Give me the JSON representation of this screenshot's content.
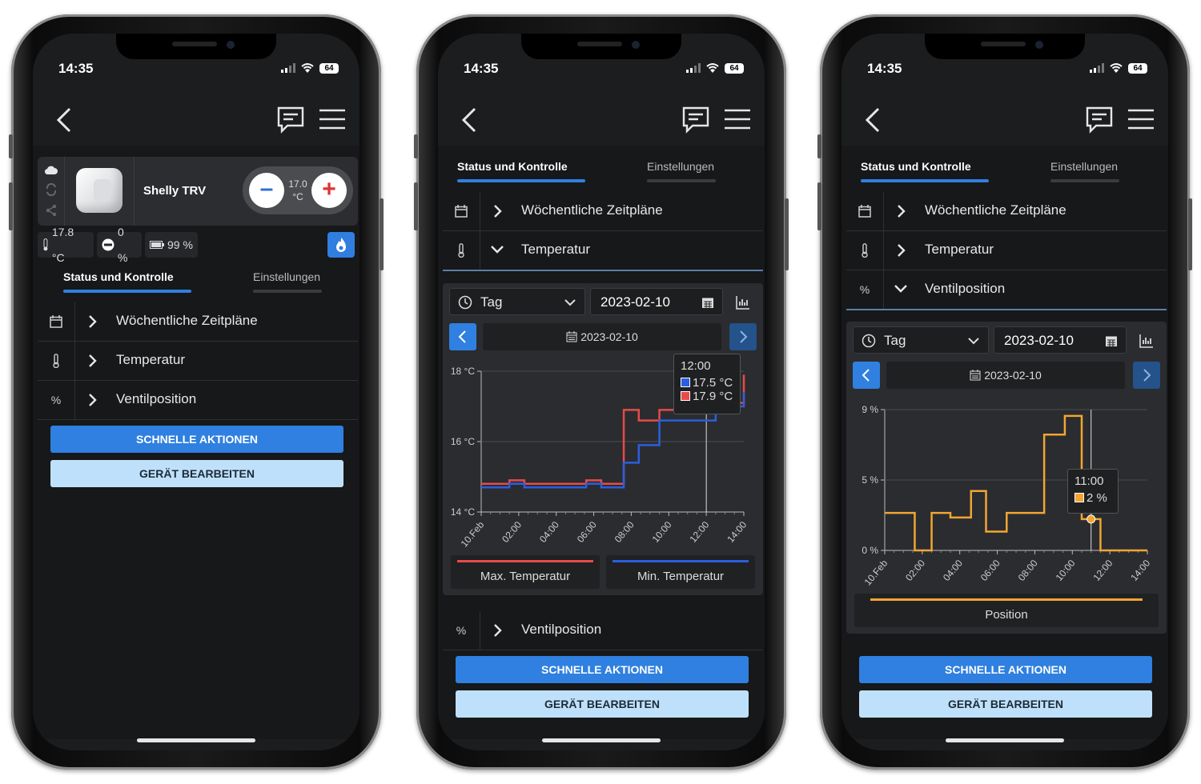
{
  "status": {
    "time": "14:35",
    "battery": "64"
  },
  "device": {
    "name": "Shelly TRV",
    "setpoint_value": "17.0",
    "setpoint_unit": "°C",
    "minus_label": "–",
    "plus_label": "+",
    "temperature": "17.8 °C",
    "valve": "0 %",
    "battery": "99 %"
  },
  "tabs": {
    "status": "Status und Kontrolle",
    "settings": "Einstellungen"
  },
  "sections": {
    "schedule": "Wöchentliche Zeitpläne",
    "temperature": "Temperatur",
    "valve": "Ventilposition"
  },
  "icons": {
    "schedule": "calendar-icon",
    "temperature": "thermometer-icon",
    "valve": "percent-icon"
  },
  "percent_symbol": "%",
  "buttons": {
    "quick_actions": "SCHNELLE AKTIONEN",
    "edit_device": "GERÄT BEARBEITEN"
  },
  "chart_controls": {
    "period": "Tag",
    "date": "2023-02-10",
    "nav_date": "2023-02-10"
  },
  "colors": {
    "accent": "#2f80e0",
    "max_temp": "#e84a4a",
    "min_temp": "#2b5fe0",
    "position": "#f2a533"
  },
  "chart_data": [
    {
      "type": "line",
      "x_ticks": [
        "10.Feb",
        "02:00",
        "04:00",
        "06:00",
        "08:00",
        "10:00",
        "12:00",
        "14:00"
      ],
      "y_ticks": [
        "18 °C",
        "16 °C",
        "14 °C"
      ],
      "ylim": [
        14,
        18
      ],
      "xlim": [
        0,
        14
      ],
      "series": [
        {
          "name": "Max. Temperatur",
          "color": "#e84a4a",
          "points": [
            [
              0,
              14.8
            ],
            [
              1.5,
              14.9
            ],
            [
              2.3,
              14.8
            ],
            [
              5.6,
              14.9
            ],
            [
              6.4,
              14.8
            ],
            [
              7.6,
              16.9
            ],
            [
              8.4,
              16.6
            ],
            [
              9.5,
              16.9
            ],
            [
              12.5,
              17.1
            ],
            [
              14,
              17.9
            ]
          ]
        },
        {
          "name": "Min. Temperatur",
          "color": "#2b5fe0",
          "points": [
            [
              0,
              14.7
            ],
            [
              1.5,
              14.8
            ],
            [
              2.3,
              14.7
            ],
            [
              5.6,
              14.8
            ],
            [
              6.4,
              14.7
            ],
            [
              7.6,
              15.4
            ],
            [
              8.4,
              15.9
            ],
            [
              9.5,
              16.6
            ],
            [
              12.5,
              17.0
            ],
            [
              14,
              17.4
            ]
          ]
        }
      ],
      "tooltip": {
        "time": "12:00",
        "min": "17.5 °C",
        "max": "17.9 °C"
      },
      "legend": [
        "Max. Temperatur",
        "Min. Temperatur"
      ]
    },
    {
      "type": "line",
      "x_ticks": [
        "10.Feb",
        "02:00",
        "04:00",
        "06:00",
        "08:00",
        "10:00",
        "12:00",
        "14:00"
      ],
      "y_ticks": [
        "9 %",
        "5 %",
        "0 %"
      ],
      "ylim": [
        0,
        9
      ],
      "xlim": [
        0,
        14
      ],
      "series": [
        {
          "name": "Position",
          "color": "#f2a533",
          "points": [
            [
              0,
              2.4
            ],
            [
              1.6,
              0
            ],
            [
              2.5,
              2.4
            ],
            [
              3.5,
              2.1
            ],
            [
              4.6,
              3.8
            ],
            [
              5.4,
              1.2
            ],
            [
              6.5,
              2.4
            ],
            [
              7.5,
              2.4
            ],
            [
              8.5,
              7.4
            ],
            [
              9.6,
              8.6
            ],
            [
              10.5,
              2
            ],
            [
              11,
              2
            ],
            [
              11.5,
              0
            ],
            [
              14,
              0
            ]
          ]
        }
      ],
      "tooltip": {
        "time": "11:00",
        "value": "2 %"
      },
      "legend": [
        "Position"
      ]
    }
  ]
}
